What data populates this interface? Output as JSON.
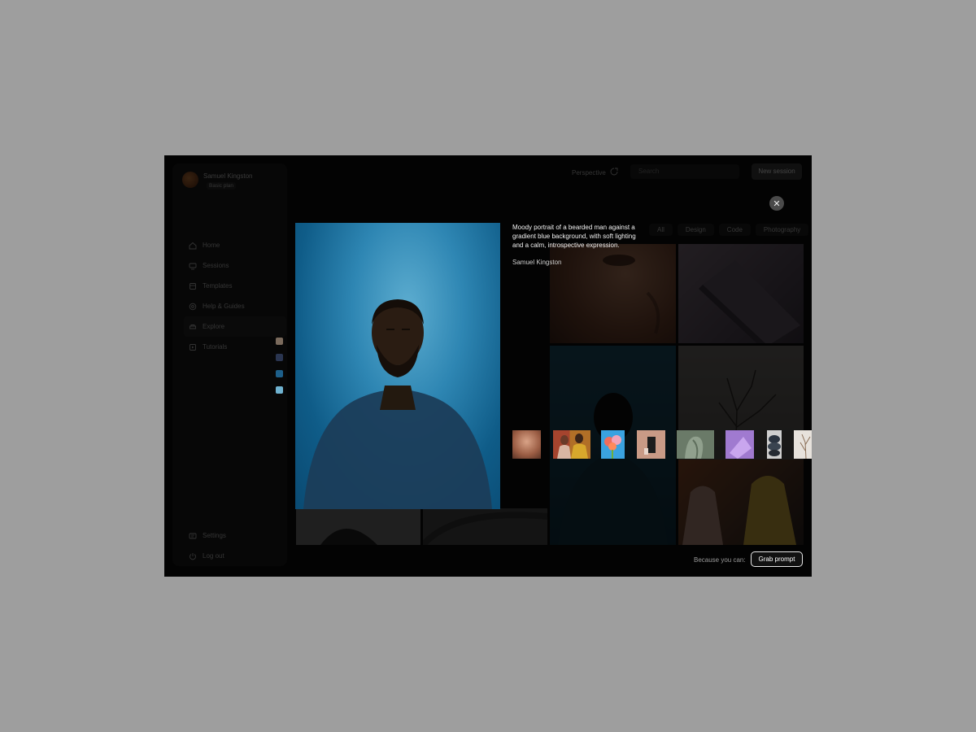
{
  "user": {
    "name": "Samuel Kingston",
    "plan": "Basic plan"
  },
  "nav": {
    "items": [
      {
        "label": "Home",
        "icon": "home-icon"
      },
      {
        "label": "Sessions",
        "icon": "sessions-icon"
      },
      {
        "label": "Templates",
        "icon": "templates-icon"
      },
      {
        "label": "Help & Guides",
        "icon": "help-icon"
      },
      {
        "label": "Explore",
        "icon": "explore-icon"
      },
      {
        "label": "Tutorials",
        "icon": "tutorials-icon"
      }
    ],
    "bottom": [
      {
        "label": "Settings",
        "icon": "settings-icon"
      },
      {
        "label": "Log out",
        "icon": "logout-icon"
      }
    ]
  },
  "topbar": {
    "perspective": "Perspective",
    "search_placeholder": "Search",
    "new_session": "New session"
  },
  "filters": [
    "All",
    "Design",
    "Code",
    "Photography"
  ],
  "modal": {
    "description": "Moody portrait of a bearded man against a gradient blue background, with soft lighting and a calm, introspective expression.",
    "author": "Samuel Kingston",
    "palette": [
      "#7a6a5c",
      "#2a3550",
      "#1d5f8a",
      "#6fb2d0"
    ]
  },
  "footer": {
    "because": "Because you can:",
    "grab_prompt": "Grab prompt"
  },
  "colors": {
    "accent": "#2e86b3",
    "background": "#0b0b0b",
    "page": "#9e9e9e"
  }
}
